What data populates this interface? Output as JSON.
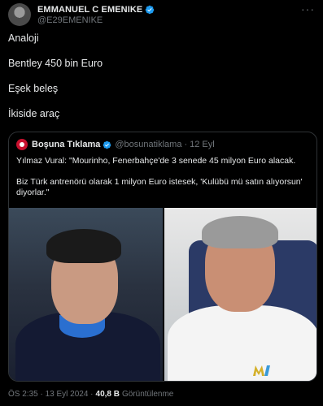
{
  "post": {
    "author_name": "EMMANUEL C EMENIKE",
    "author_handle": "@E29EMENIKE",
    "more_label": "···",
    "lines": [
      "Analoji",
      "Bentley 450 bin Euro",
      "Eşek beleş",
      "İkiside araç"
    ]
  },
  "quote": {
    "name": "Boşuna Tıklama",
    "handle": "@bosunatiklama",
    "dot": "·",
    "date": "12 Eyl",
    "text1": "Yılmaz Vural: \"Mourinho, Fenerbahçe'de 3 senede 45 milyon Euro alacak.",
    "text2": "Biz Türk antrenörü olarak 1 milyon Euro istesek, 'Kulübü mü satın alıyorsun' diyorlar.\""
  },
  "meta": {
    "time_date": "ÖS 2:35 · 13 Eyl 2024 ·",
    "views_count": "40,8 B",
    "views_label": "Görüntülenme"
  },
  "colors": {
    "background": "#000000",
    "text": "#e7e9ea",
    "secondary": "#71767b",
    "verified": "#1d9bf0",
    "border": "#2f3336"
  }
}
